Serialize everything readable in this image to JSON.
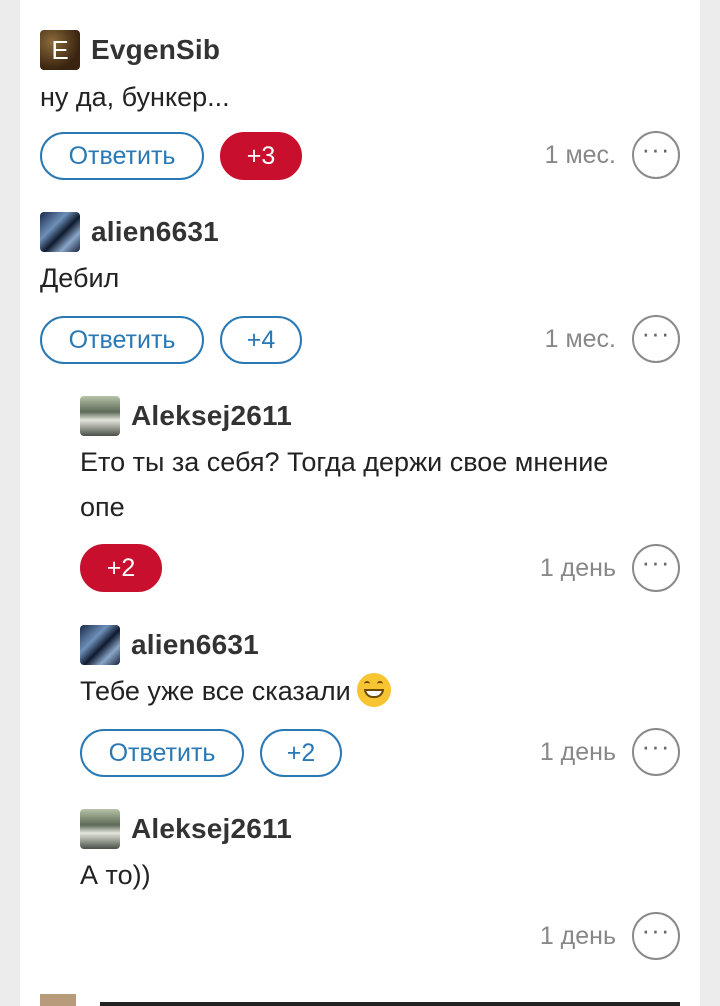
{
  "reply_label": "Ответить",
  "more_glyph": "···",
  "colors": {
    "accent": "#2a78b4",
    "vote_positive": "#c8102e"
  },
  "comments": [
    {
      "author": "EvgenSib",
      "avatar_letter": "E",
      "text": "ну да, бункер...",
      "vote": "+3",
      "time": "1 мес."
    },
    {
      "author": "alien6631",
      "text": "Дебил",
      "vote": "+4",
      "time": "1 мес."
    },
    {
      "author": "Aleksej2611",
      "text": "Ето ты за себя? Тогда держи свое мнение",
      "text_line2": "опе",
      "vote": "+2",
      "time": "1 день"
    },
    {
      "author": "alien6631",
      "text": "Тебе уже все сказали",
      "emoji": "grinning-face-emoji",
      "vote": "+2",
      "time": "1 день"
    },
    {
      "author": "Aleksej2611",
      "text": "А то))",
      "time": "1 день"
    }
  ]
}
